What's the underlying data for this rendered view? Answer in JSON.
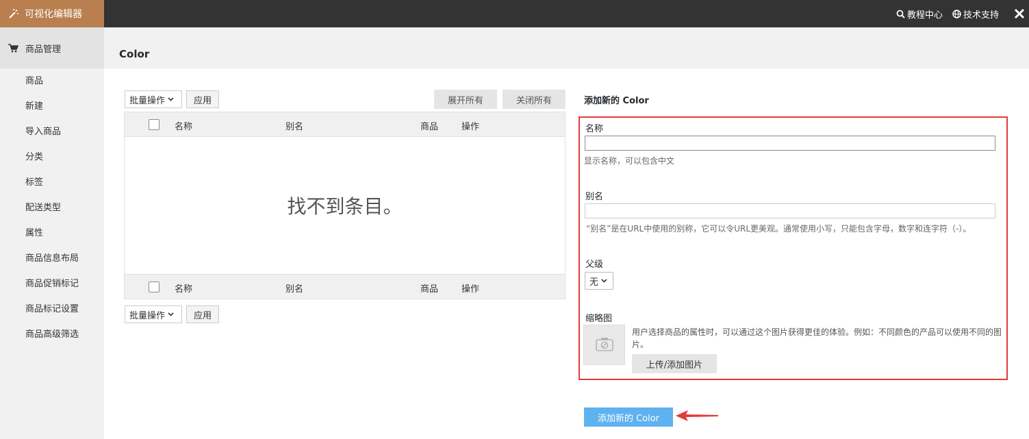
{
  "app": {
    "title": "可视化编辑器"
  },
  "top_links": {
    "tutorial": "教程中心",
    "support": "技术支持"
  },
  "sidebar": {
    "header": "商品管理",
    "items": [
      {
        "label": "商品"
      },
      {
        "label": "新建"
      },
      {
        "label": "导入商品"
      },
      {
        "label": "分类"
      },
      {
        "label": "标签"
      },
      {
        "label": "配送类型"
      },
      {
        "label": "属性"
      },
      {
        "label": "商品信息布局"
      },
      {
        "label": "商品促销标记"
      },
      {
        "label": "商品标记设置"
      },
      {
        "label": "商品高级筛选"
      }
    ]
  },
  "page": {
    "title": "Color"
  },
  "list": {
    "bulk_action": "批量操作",
    "apply": "应用",
    "expand_all": "展开所有",
    "collapse_all": "关闭所有",
    "columns": {
      "name": "名称",
      "slug": "别名",
      "products": "商品",
      "actions": "操作"
    },
    "empty": "找不到条目。"
  },
  "form": {
    "title": "添加新的 Color",
    "name_label": "名称",
    "name_value": "",
    "name_hint": "显示名称，可以包含中文",
    "slug_label": "别名",
    "slug_value": "",
    "slug_hint": "“别名”是在URL中使用的别称，它可以令URL更美观。通常使用小写，只能包含字母，数字和连字符（-）。",
    "parent_label": "父级",
    "parent_value": "无",
    "thumb_label": "缩略图",
    "thumb_desc": "用户选择商品的属性时，可以通过这个图片获得更佳的体验。例如：不同颜色的产品可以使用不同的图片。",
    "upload": "上传/添加图片",
    "submit": "添加新的 Color"
  },
  "colors": {
    "brand": "#b97f4f",
    "topbar": "#333333",
    "highlight": "#e23b3b",
    "primary": "#5eb2f0"
  }
}
